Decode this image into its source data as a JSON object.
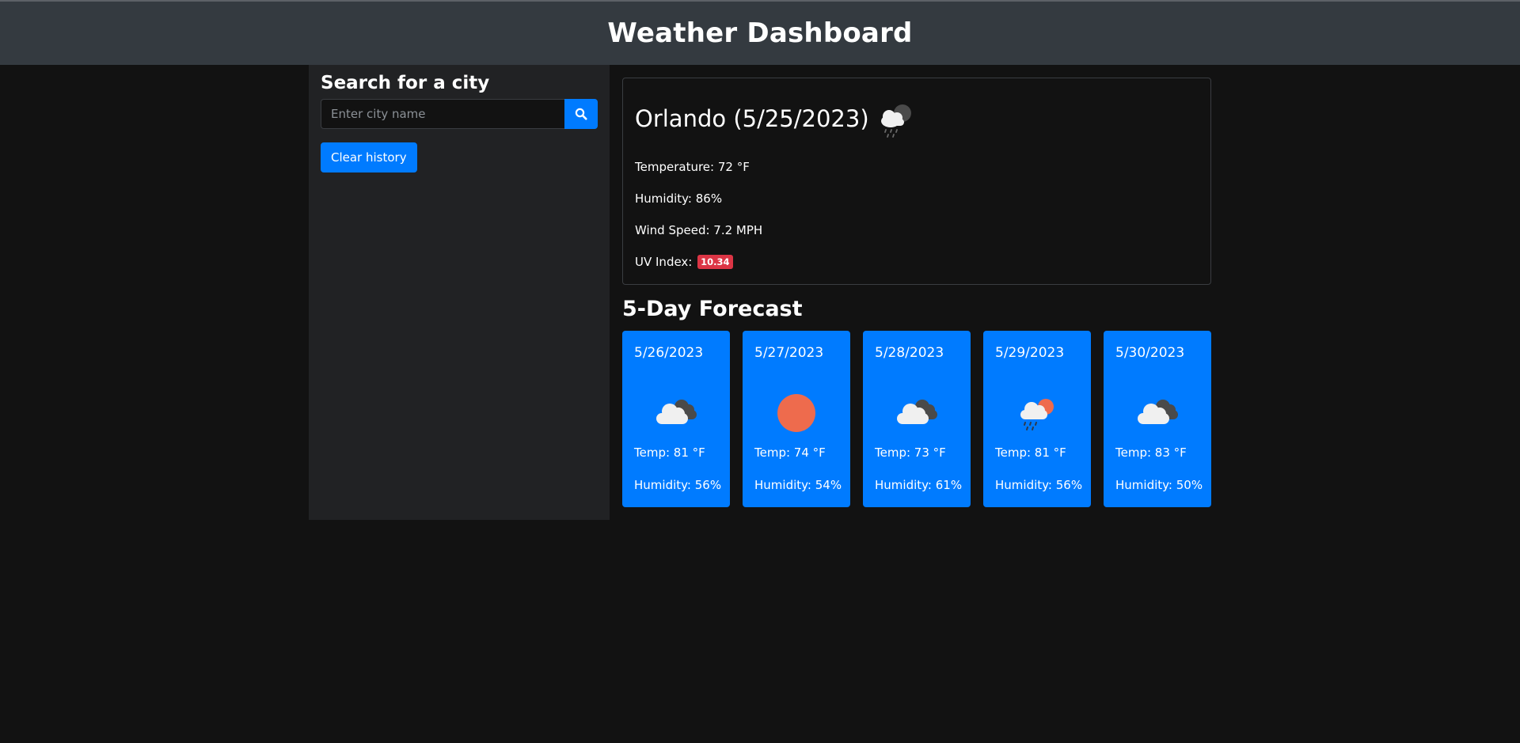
{
  "header": {
    "title": "Weather Dashboard"
  },
  "sidebar": {
    "heading": "Search for a city",
    "search_placeholder": "Enter city name",
    "search_icon": "search-icon",
    "clear_label": "Clear history"
  },
  "current": {
    "city_date": "Orlando (5/25/2023)",
    "icon": "cloud-rain-icon",
    "temperature": "Temperature: 72 °F",
    "humidity": "Humidity: 86%",
    "wind": "Wind Speed: 7.2 MPH",
    "uv_label": "UV Index:",
    "uv_value": "10.34"
  },
  "forecast": {
    "title": "5-Day Forecast",
    "days": [
      {
        "date": "5/26/2023",
        "icon": "clouds-icon",
        "temp": "Temp: 81 °F",
        "humidity": "Humidity: 56%"
      },
      {
        "date": "5/27/2023",
        "icon": "sun-icon",
        "temp": "Temp: 74 °F",
        "humidity": "Humidity: 54%"
      },
      {
        "date": "5/28/2023",
        "icon": "clouds-icon",
        "temp": "Temp: 73 °F",
        "humidity": "Humidity: 61%"
      },
      {
        "date": "5/29/2023",
        "icon": "sun-cloud-rain-icon",
        "temp": "Temp: 81 °F",
        "humidity": "Humidity: 56%"
      },
      {
        "date": "5/30/2023",
        "icon": "clouds-icon",
        "temp": "Temp: 83 °F",
        "humidity": "Humidity: 50%"
      }
    ]
  },
  "colors": {
    "accent": "#007bff",
    "header_bg": "#343a40",
    "sidebar_bg": "#212224",
    "page_bg": "#121212",
    "uv_badge": "#dc3545",
    "sun": "#ee6b4d"
  }
}
